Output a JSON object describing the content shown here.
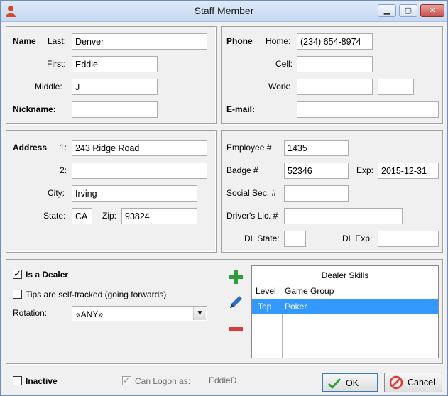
{
  "window": {
    "title": "Staff Member",
    "min_label": "▁",
    "max_label": "▢",
    "close_label": "✕"
  },
  "name": {
    "section_label": "Name",
    "last_label": "Last:",
    "last_value": "Denver",
    "first_label": "First:",
    "first_value": "Eddie",
    "middle_label": "Middle:",
    "middle_value": "J",
    "nickname_label": "Nickname:",
    "nickname_value": ""
  },
  "phone": {
    "section_label": "Phone",
    "home_label": "Home:",
    "home_value": "(234) 654-8974",
    "cell_label": "Cell:",
    "cell_value": "",
    "work_label": "Work:",
    "work_value": "",
    "work_ext_value": "",
    "email_label": "E-mail:",
    "email_value": ""
  },
  "address": {
    "section_label": "Address",
    "line1_label": "1:",
    "line1_value": "243 Ridge Road",
    "line2_label": "2:",
    "line2_value": "",
    "city_label": "City:",
    "city_value": "Irving",
    "state_label": "State:",
    "state_value": "CA",
    "zip_label": "Zip:",
    "zip_value": "93824"
  },
  "employee": {
    "employee_label": "Employee #",
    "employee_value": "1435",
    "badge_label": "Badge #",
    "badge_value": "52346",
    "exp_label": "Exp:",
    "exp_value": "2015-12-31",
    "ssn_label": "Social Sec. #",
    "ssn_value": "",
    "dl_label": "Driver's Lic. #",
    "dl_value": "",
    "dl_state_label": "DL State:",
    "dl_state_value": "",
    "dl_exp_label": "DL Exp:",
    "dl_exp_value": ""
  },
  "dealer": {
    "is_dealer_label": "Is a Dealer",
    "is_dealer": true,
    "tips_label": "Tips are self-tracked (going forwards)",
    "tips": false,
    "rotation_label": "Rotation:",
    "rotation_value": "«ANY»",
    "skills": {
      "title": "Dealer Skills",
      "columns": [
        "Level",
        "Game Group"
      ],
      "rows": [
        {
          "level": "Top",
          "game_group": "Poker"
        }
      ]
    }
  },
  "footer": {
    "inactive_label": "Inactive",
    "inactive": false,
    "logon_label": "Can Logon as:",
    "logon": true,
    "logon_value": "EddieD",
    "ok_label": "OK",
    "cancel_label": "Cancel"
  },
  "colors": {
    "selection": "#3399ff",
    "add": "#2e9e3a",
    "edit": "#2c6fc4",
    "remove": "#d93b3b"
  }
}
